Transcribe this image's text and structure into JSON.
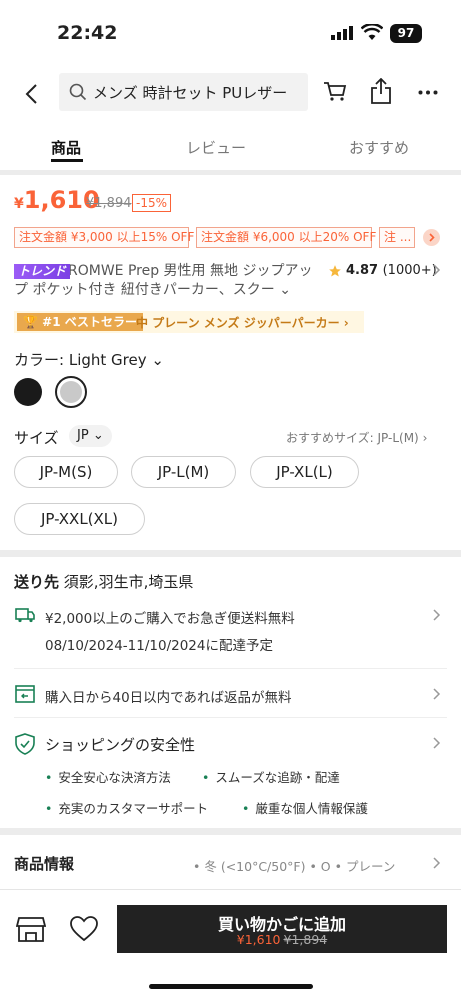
{
  "status": {
    "time": "22:42",
    "battery": "97"
  },
  "header": {
    "search_text": "メンズ 時計セット PUレザー"
  },
  "tabs": [
    "商品",
    "レビュー",
    "おすすめ"
  ],
  "price": {
    "currency": "¥",
    "current": "1,610",
    "original": "¥1,894",
    "discount": "-15%"
  },
  "coupons": [
    "注文金額 ¥3,000 以上15% OFF",
    "注文金額 ¥6,000 以上20% OFF",
    "注 ..."
  ],
  "product": {
    "badge": "トレンド",
    "title": "ROMWE Prep 男性用 無地 ジップアップ ポケット付き 紐付きパーカー、スクー",
    "rating": "4.87",
    "rating_count": "(1000+)"
  },
  "bestseller": {
    "badge": "#1 ベストセラー",
    "category": "中 プレーン メンズ ジッパーパーカー"
  },
  "color": {
    "label": "カラー:",
    "selected": "Light Grey"
  },
  "size": {
    "label": "サイズ",
    "region": "JP",
    "recommended": "おすすめサイズ: JP-L(M)",
    "options": [
      "JP-M(S)",
      "JP-L(M)",
      "JP-XL(L)",
      "JP-XXL(XL)"
    ]
  },
  "shipping": {
    "to_label": "送り先",
    "to_value": "須影,羽生市,埼玉県",
    "free_shipping": "¥2,000以上のご購入でお急ぎ便送料無料",
    "delivery_date": "08/10/2024-11/10/2024に配達予定",
    "returns": "購入日から40日以内であれば返品が無料"
  },
  "safety": {
    "title": "ショッピングの安全性",
    "bullets": [
      "安全安心な決済方法",
      "スムーズな追跡・配達",
      "充実のカスタマーサポート",
      "厳重な個人情報保護"
    ]
  },
  "info": {
    "title": "商品情報",
    "tags": "• 冬 (<10°C/50°F)   • O   • プレーン"
  },
  "bottom": {
    "add_to_cart": "買い物かごに追加",
    "price": "¥1,610",
    "original": "¥1,894"
  },
  "colors": {
    "accent": "#fa6338",
    "gold": "#e9a84d",
    "green": "#198055"
  }
}
